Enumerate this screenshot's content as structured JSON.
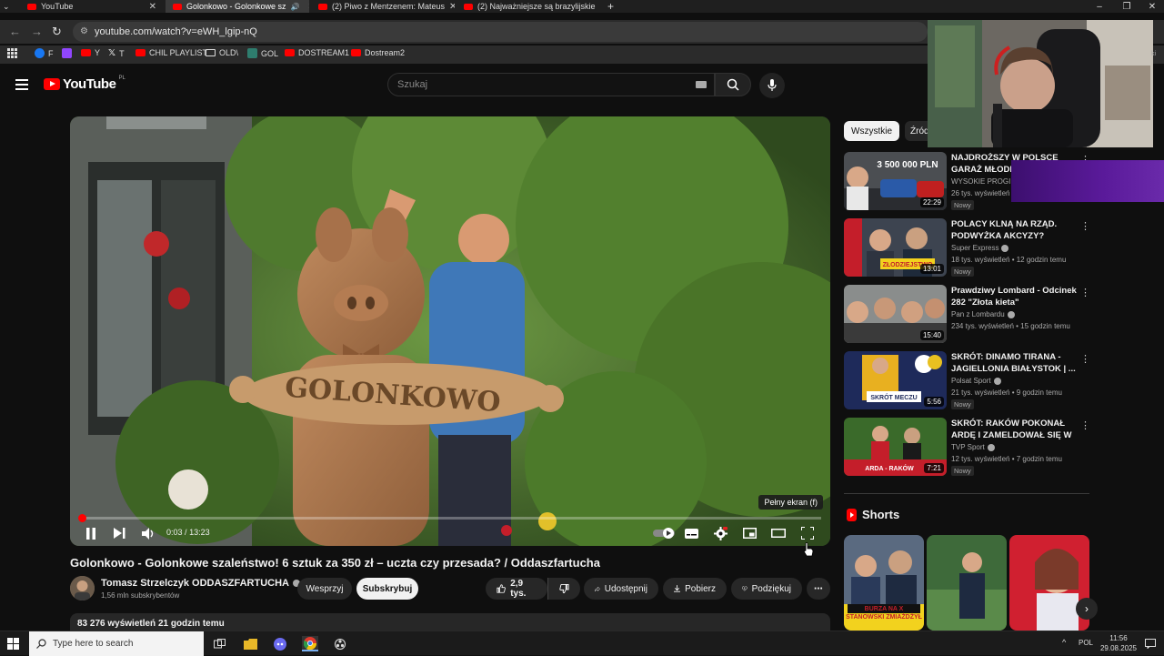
{
  "browser": {
    "tabs": [
      {
        "label": "YouTube"
      },
      {
        "label": "Golonkowo - Golonkowe sz"
      },
      {
        "label": "(2) Piwo z Mentzenem: Mateus"
      },
      {
        "label": "(2) Najważniejsze są brazylijskie"
      }
    ],
    "url": "youtube.com/watch?v=eWH_lgip-nQ",
    "bookmarks": [
      "F",
      "Y",
      "T",
      "CHIL PLAYLIST",
      "OLD\\",
      "GOL",
      "DOSTREAM1",
      "Dostream2"
    ]
  },
  "header": {
    "logo_text": "YouTube",
    "country": "PL",
    "search_placeholder": "Szukaj"
  },
  "player": {
    "fullscreen_tooltip": "Pełny ekran (f)",
    "time_current": "0:03",
    "time_separator": "/",
    "time_total": "13:23",
    "progress": 0.004,
    "sign_text": "GOLONKOWO"
  },
  "video": {
    "title": "Golonkowo - Golonkowe szaleństwo! 6 sztuk za 350 zł – uczta czy przesada? / Oddaszfartucha",
    "channel": "Tomasz Strzelczyk ODDASZFARTUCHA",
    "subscribers": "1,56 mln subskrybentów",
    "support_label": "Wesprzyj",
    "subscribe_label": "Subskrybuj",
    "likes": "2,9 tys.",
    "share_label": "Udostępnij",
    "download_label": "Pobierz",
    "thanks_label": "Podziękuj",
    "views_line": "83 276 wyświetleń  21 godzin temu"
  },
  "sidebar": {
    "chips": [
      "Wszystkie",
      "Źród"
    ],
    "recommendations": [
      {
        "title": "NAJDROŻSZY W POLSCE GARAŻ MŁODEG",
        "channel": "WYSOKIE PROGI",
        "meta": "26 tys. wyświetleń",
        "badge": "Nowy",
        "duration": "22:29",
        "thumb_text": "3 500 000 PLN"
      },
      {
        "title": "POLACY KLNĄ NA RZĄD. PODWYŻKA AKCYZY? WÓDKA...",
        "channel": "Super Express",
        "meta": "18 tys. wyświetleń • 12 godzin temu",
        "badge": "Nowy",
        "duration": "13:01",
        "thumb_text": "ZŁODZIEJSTWO"
      },
      {
        "title": "Prawdziwy Lombard - Odcinek 282 \"Złota kieta\"",
        "channel": "Pan z Lombardu",
        "meta": "234 tys. wyświetleń • 15 godzin temu",
        "badge": "",
        "duration": "15:40",
        "thumb_text": ""
      },
      {
        "title": "SKRÓT: DINAMO TIRANA - JAGIELLONIA BIAŁYSTOK | ...",
        "channel": "Polsat Sport",
        "meta": "21 tys. wyświetleń • 9 godzin temu",
        "badge": "Nowy",
        "duration": "5:56",
        "thumb_text": "SKRÓT MECZU"
      },
      {
        "title": "SKRÓT: RAKÓW POKONAŁ ARDĘ I ZAMELDOWAŁ SIĘ W ...",
        "channel": "TVP Sport",
        "meta": "12 tys. wyświetleń • 7 godzin temu",
        "badge": "Nowy",
        "duration": "7:21",
        "thumb_text": "ARDA - RAKÓW"
      }
    ],
    "shorts_title": "Shorts",
    "shorts": [
      {
        "caption": "BURZA NA X STANOWSKI ZMIAŻDŻYŁ"
      },
      {
        "caption": ""
      },
      {
        "caption": ""
      }
    ]
  },
  "taskbar": {
    "search_placeholder": "Type here to search",
    "lang": "POL",
    "time": "11:56",
    "date": "29.08.2025"
  },
  "colors": {
    "brand_red": "#ff0000",
    "background": "#0f0f0f",
    "surface": "#272727"
  }
}
